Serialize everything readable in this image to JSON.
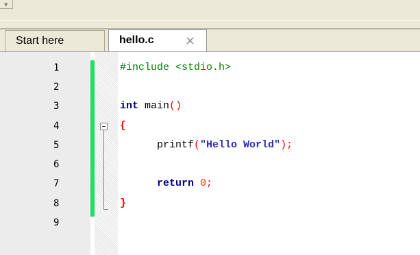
{
  "tabs": [
    {
      "label": "Start here",
      "active": false
    },
    {
      "label": "hello.c",
      "active": true,
      "close_icon": "×"
    }
  ],
  "editor": {
    "line_numbers": [
      "1",
      "2",
      "3",
      "4",
      "5",
      "6",
      "7",
      "8",
      "9"
    ],
    "code": {
      "line1_directive": "#include <stdio.h>",
      "line3_type": "int",
      "line3_name": " main",
      "line3_parens": "()",
      "line4_open": "{",
      "line5_func": "printf",
      "line5_lparen": "(",
      "line5_string": "\"Hello World\"",
      "line5_rparen_semi": ");",
      "line7_indent": "    ",
      "line7_keyword": "return",
      "line7_value": "0",
      "line7_semi": ";",
      "line8_close": "}"
    }
  },
  "colors": {
    "change_bar": "#22dd66",
    "keyword": "#00007f",
    "preprocessor": "#007f00",
    "string": "#2e2eb8",
    "operator": "#ff0000"
  }
}
